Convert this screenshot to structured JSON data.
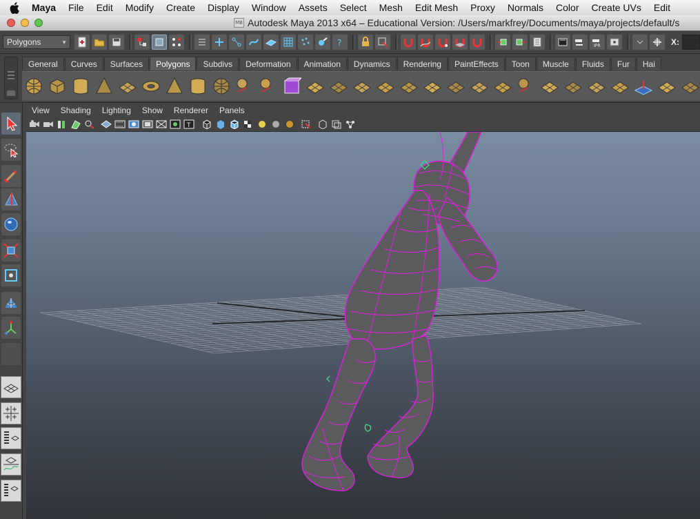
{
  "menubar": {
    "app_name": "Maya",
    "items": [
      "File",
      "Edit",
      "Modify",
      "Create",
      "Display",
      "Window",
      "Assets",
      "Select",
      "Mesh",
      "Edit Mesh",
      "Proxy",
      "Normals",
      "Color",
      "Create UVs",
      "Edit"
    ]
  },
  "window": {
    "title": "Autodesk Maya 2013 x64 – Educational Version: /Users/markfrey/Documents/maya/projects/default/s",
    "doc_icon_label": "MB"
  },
  "status_line": {
    "mode": "Polygons",
    "x_label": "X:"
  },
  "shelf": {
    "tabs": [
      "General",
      "Curves",
      "Surfaces",
      "Polygons",
      "Subdivs",
      "Deformation",
      "Animation",
      "Dynamics",
      "Rendering",
      "PaintEffects",
      "Toon",
      "Muscle",
      "Fluids",
      "Fur",
      "Hai"
    ],
    "active_tab": "Polygons",
    "icons": [
      "sphere-icon",
      "cube-icon",
      "cylinder-icon",
      "cone-icon",
      "plane-icon",
      "torus-icon",
      "pyramid-icon",
      "pipe-icon",
      "soccer-ball-icon",
      "combine-icon",
      "separate-icon",
      "extract-icon",
      "smooth-icon",
      "average-vertices-icon",
      "extrude-icon",
      "bridge-icon",
      "append-icon",
      "split-icon",
      "insert-edgeloop-icon",
      "offset-edgeloop-icon",
      "wedge-icon",
      "merge-icon",
      "delete-edge-icon",
      "chamfer-icon",
      "bevel-icon",
      "mirror-icon",
      "sculpt-icon",
      "triangulate-icon",
      "quadrangulate-icon",
      "checker-icon"
    ]
  },
  "viewport": {
    "menu": [
      "View",
      "Shading",
      "Lighting",
      "Show",
      "Renderer",
      "Panels"
    ]
  },
  "colors": {
    "ui_bg": "#444444",
    "wireframe": "#e01ee0",
    "mesh": "#5a5a5a",
    "grid": "#9aa0a6",
    "selection": "#3cdc8c"
  }
}
